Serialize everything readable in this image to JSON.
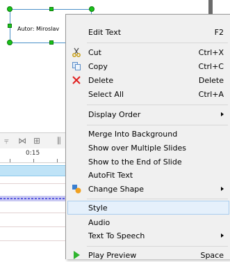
{
  "slide": {
    "textbox_text": "Autor: Miroslav"
  },
  "timeline": {
    "time_label": "0:15"
  },
  "menu": {
    "items": [
      {
        "label": "Edit Text",
        "shortcut": "F2"
      },
      {
        "label": "Cut",
        "shortcut": "Ctrl+X",
        "icon": "scissors-icon"
      },
      {
        "label": "Copy",
        "shortcut": "Ctrl+C",
        "icon": "copy-icon"
      },
      {
        "label": "Delete",
        "shortcut": "Delete",
        "icon": "delete-x-icon"
      },
      {
        "label": "Select All",
        "shortcut": "Ctrl+A"
      },
      {
        "label": "Display Order",
        "submenu": true
      },
      {
        "label": "Merge Into Background"
      },
      {
        "label": "Show over Multiple Slides"
      },
      {
        "label": "Show to the End of Slide"
      },
      {
        "label": "AutoFit Text"
      },
      {
        "label": "Change Shape",
        "submenu": true,
        "icon": "change-shape-icon"
      },
      {
        "label": "Style",
        "highlighted": true
      },
      {
        "label": "Audio"
      },
      {
        "label": "Text To Speech",
        "submenu": true
      },
      {
        "label": "Play Preview",
        "shortcut": "Space",
        "icon": "play-icon"
      }
    ]
  },
  "colors": {
    "menu_bg": "#f0f0f0",
    "highlight_bg": "#e5f0fb",
    "highlight_border": "#a9cdef",
    "handle_green": "#19c219",
    "cut_icon": "#c9a11a",
    "delete_icon": "#e02020",
    "play_icon": "#2fb52f"
  }
}
